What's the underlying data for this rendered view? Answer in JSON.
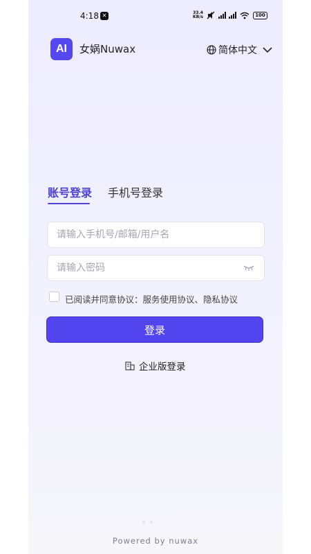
{
  "status_bar": {
    "time": "4:18",
    "net_speed_value": "33.4",
    "net_speed_unit": "KB/s",
    "battery": "100",
    "hd_label": "HD"
  },
  "header": {
    "logo_text": "AI",
    "brand_name": "女娲Nuwax",
    "language_label": "简体中文"
  },
  "tabs": [
    {
      "label": "账号登录",
      "active": true
    },
    {
      "label": "手机号登录",
      "active": false
    }
  ],
  "form": {
    "account_placeholder": "请输入手机号/邮箱/用户名",
    "password_placeholder": "请输入密码",
    "agreement_text": "已阅读并同意协议：服务使用协议、隐私协议",
    "agreement_checked": false,
    "login_label": "登录"
  },
  "enterprise_login_label": "企业版登录",
  "footer": {
    "powered_by": "Powered by nuwax"
  },
  "colors": {
    "accent": "#5245f0",
    "tab_active": "#4c43d6",
    "background_top": "#eeecff"
  }
}
